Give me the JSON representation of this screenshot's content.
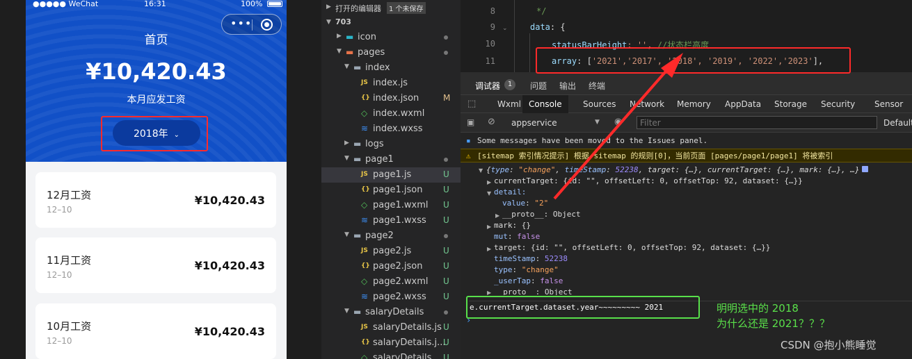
{
  "phone": {
    "status": {
      "carrier": "●●●●● WeChat",
      "time": "16:31",
      "battery": "100%"
    },
    "capsule": {
      "dots": "•••"
    },
    "title": "首页",
    "amount": "¥10,420.43",
    "subtitle": "本月应发工资",
    "year_button": "2018年",
    "cards": [
      {
        "title": "12月工资",
        "date": "12–10",
        "amount": "¥10,420.43"
      },
      {
        "title": "11月工资",
        "date": "12–10",
        "amount": "¥10,420.43"
      },
      {
        "title": "10月工资",
        "date": "12–10",
        "amount": "¥10,420.43"
      }
    ]
  },
  "tree": {
    "open_editors": "打开的编辑器",
    "unsaved_badge": "1 个未保存",
    "project": "703",
    "rows": [
      {
        "name": "icon",
        "type": "folder",
        "depth": 0,
        "expanded": false,
        "status": "dot"
      },
      {
        "name": "pages",
        "type": "folder",
        "depth": 0,
        "expanded": true,
        "status": "dot"
      },
      {
        "name": "index",
        "type": "folder",
        "depth": 1,
        "expanded": true,
        "status": ""
      },
      {
        "name": "index.js",
        "type": "js",
        "depth": 2,
        "status": ""
      },
      {
        "name": "index.json",
        "type": "json",
        "depth": 2,
        "status": "M"
      },
      {
        "name": "index.wxml",
        "type": "wxml",
        "depth": 2,
        "status": ""
      },
      {
        "name": "index.wxss",
        "type": "wxss",
        "depth": 2,
        "status": ""
      },
      {
        "name": "logs",
        "type": "folder",
        "depth": 1,
        "expanded": false,
        "status": ""
      },
      {
        "name": "page1",
        "type": "folder",
        "depth": 1,
        "expanded": true,
        "status": "dot"
      },
      {
        "name": "page1.js",
        "type": "js",
        "depth": 2,
        "status": "U",
        "selected": true
      },
      {
        "name": "page1.json",
        "type": "json",
        "depth": 2,
        "status": "U"
      },
      {
        "name": "page1.wxml",
        "type": "wxml",
        "depth": 2,
        "status": "U"
      },
      {
        "name": "page1.wxss",
        "type": "wxss",
        "depth": 2,
        "status": "U"
      },
      {
        "name": "page2",
        "type": "folder",
        "depth": 1,
        "expanded": true,
        "status": "dot"
      },
      {
        "name": "page2.js",
        "type": "js",
        "depth": 2,
        "status": "U"
      },
      {
        "name": "page2.json",
        "type": "json",
        "depth": 2,
        "status": "U"
      },
      {
        "name": "page2.wxml",
        "type": "wxml",
        "depth": 2,
        "status": "U"
      },
      {
        "name": "page2.wxss",
        "type": "wxss",
        "depth": 2,
        "status": "U"
      },
      {
        "name": "salaryDetails",
        "type": "folder",
        "depth": 1,
        "expanded": true,
        "status": "dot"
      },
      {
        "name": "salaryDetails.js",
        "type": "js",
        "depth": 2,
        "status": "U"
      },
      {
        "name": "salaryDetails.j...",
        "type": "json",
        "depth": 2,
        "status": "U"
      },
      {
        "name": "salaryDetails...",
        "type": "wxml",
        "depth": 2,
        "status": "U"
      }
    ]
  },
  "editor": {
    "line_numbers": [
      "8",
      "9",
      "10",
      "11"
    ],
    "l8": "*/",
    "l9_key": "data",
    "l9_rest": ": {",
    "l10_key": "statusBarHeight",
    "l10_val": ": '', ",
    "l10_comment": "//状态栏高度",
    "l11_key": "array",
    "l11_rest": ": [",
    "l11_vals": "'2021','2017', '2018', '2019', '2022','2023'",
    "l11_end": "],"
  },
  "devtools": {
    "tabs": {
      "debugger": "调试器",
      "count": "1",
      "issues": "问题",
      "output": "输出",
      "terminal": "终端"
    },
    "panel_tabs": [
      "Wxml",
      "Console",
      "Sources",
      "Network",
      "Memory",
      "AppData",
      "Storage",
      "Security",
      "Sensor"
    ],
    "active_panel": "Console",
    "context": "appservice",
    "filter_placeholder": "Filter",
    "default_levels": "Default",
    "messages": {
      "info": "Some messages have been moved to the Issues panel.",
      "warn": "[sitemap 索引情况提示] 根据 sitemap 的规则[0]，当前页面 [pages/page1/page1] 将被索引"
    },
    "obj": {
      "summary_type_key": "type",
      "summary_type_val": "\"change\"",
      "summary_ts_key": "timeStamp",
      "summary_ts_val": "52238",
      "summary_rest": ", target: {…}, currentTarget: {…}, mark: {…}, …}",
      "currentTarget": "currentTarget: {id: \"\", offsetLeft: 0, offsetTop: 92, dataset: {…}}",
      "detail": "detail:",
      "value_key": "value",
      "value_val": "\"2\"",
      "proto1": "__proto__: Object",
      "mark": "mark: {}",
      "mut_key": "mut",
      "mut_val": "false",
      "target": "target: {id: \"\", offsetLeft: 0, offsetTop: 92, dataset: {…}}",
      "ts_key": "timeStamp",
      "ts_val": "52238",
      "type_key": "type",
      "type_val": "\"change\"",
      "usertap_key": "_userTap",
      "usertap_val": "false",
      "proto2": "__proto__: Object"
    },
    "log": "e.currentTarget.dataset.year~~~~~~~~~ 2021"
  },
  "annotation": {
    "line1": "明明选中的 2018",
    "line2": "为什么还是 2021？？？"
  },
  "watermark": "CSDN @抱小熊睡觉",
  "colors": {
    "phone_blue": "#1150c7",
    "red_box": "#ff2a2a",
    "green_box": "#58e04b"
  }
}
